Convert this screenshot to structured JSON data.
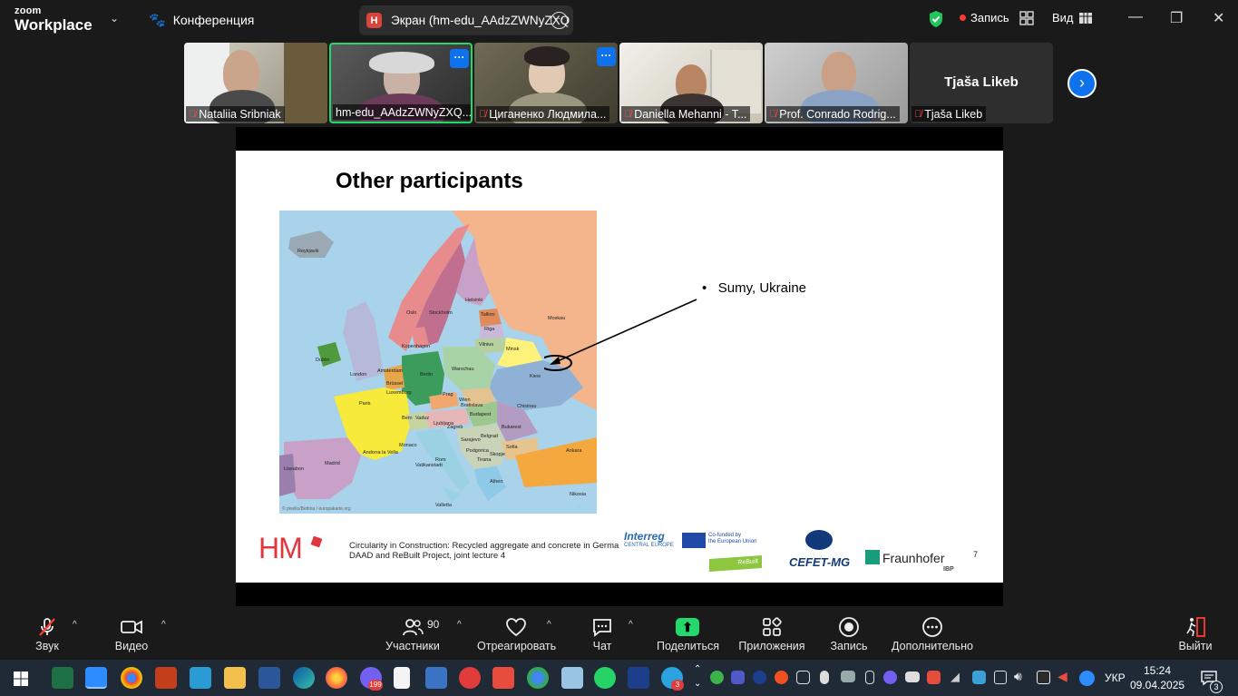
{
  "topbar": {
    "logo_line1": "zoom",
    "logo_line2": "Workplace",
    "conference_label": "Конференция",
    "screen_badge": "H",
    "screen_title": "Экран (hm-edu_AAdzZWNyZXQ",
    "record_label": "Запись",
    "view_label": "Вид"
  },
  "participants": [
    {
      "name": "Nataliia Sribniak"
    },
    {
      "name": "hm-edu_AAdzZWNyZXQ..."
    },
    {
      "name": "Циганенко Людмила..."
    },
    {
      "name": "Daniella Mehanni - T..."
    },
    {
      "name": "Prof. Conrado Rodrig..."
    },
    {
      "name": "Tjaša Likeb",
      "big_name": "Tjaša Likeb"
    }
  ],
  "slide": {
    "title": "Other participants",
    "bullet": "Sumy, Ukraine",
    "footer_line1": "Circularity in Construction: Recycled aggregate and concrete in Germa",
    "footer_line2": "DAAD and ReBuilt Project, joint lecture 4",
    "hm_logo": "HM",
    "interreg": "Interreg",
    "interreg_sub": "CENTRAL EUROPE",
    "eu_text_1": "Co-funded by",
    "eu_text_2": "the European Union",
    "rebuilt": "ReBuilt",
    "cefet": "CEFET-MG",
    "fraunhofer": "Fraunhofer",
    "fraunhofer_sub": "IBP",
    "page_number": "7",
    "map_cities": [
      "Reykjavik",
      "Oslo",
      "Stockholm",
      "Helsinki",
      "Tallinn",
      "Riga",
      "Moskau",
      "Vilnius",
      "Minsk",
      "Kopenhagen",
      "Dublin",
      "London",
      "Amsterdam",
      "Berlin",
      "Warschau",
      "Kiew",
      "Brüssel",
      "Luxemburg",
      "Prag",
      "Paris",
      "Bern",
      "Vaduz",
      "Wien",
      "Bratislava",
      "Budapest",
      "Chisinau",
      "Ljubljana",
      "Zagreb",
      "Sarajevo",
      "Belgrad",
      "Bukarest",
      "Sofia",
      "Skopje",
      "Tirana",
      "Podgorica",
      "Rom",
      "Vatikanstadt",
      "Monaco",
      "Andorra la Vella",
      "Madrid",
      "Lissabon",
      "Athen",
      "Ankara",
      "Nikosia",
      "Valletta"
    ],
    "map_credit": "© pixelio/Bettina / europakarte.org"
  },
  "toolbar": {
    "audio": "Звук",
    "video": "Видео",
    "participants": "Участники",
    "participants_count": "90",
    "react": "Отреагировать",
    "chat": "Чат",
    "share": "Поделиться",
    "apps": "Приложения",
    "record": "Запись",
    "more": "Дополнительно",
    "leave": "Выйти"
  },
  "taskbar": {
    "lang": "УКР",
    "time": "15:24",
    "date": "09.04.2025",
    "viber_badge": "199",
    "telegram_badge": "3",
    "notif_badge": "3"
  },
  "colors": {
    "accent_blue": "#0e72ed",
    "share_green": "#23d96b",
    "record_red": "#ff3b30",
    "hm_red": "#e2363c"
  }
}
